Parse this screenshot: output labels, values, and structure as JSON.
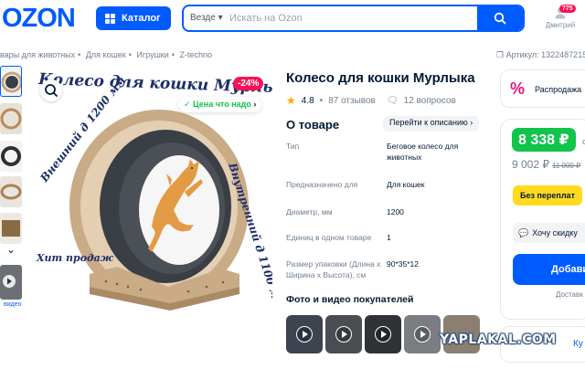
{
  "header": {
    "logo": "OZON",
    "catalog_label": "Каталог",
    "search_scope": "Везде",
    "search_placeholder": "Искать на Ozon",
    "user_label": "Дмитрий",
    "notifications_count": "775"
  },
  "breadcrumbs": [
    "вары для животных",
    "Для кошек",
    "Игрушки",
    "Z-techno"
  ],
  "article": "Артикул: 1322487215",
  "gallery": {
    "video_label": "видео",
    "discount": "-24%",
    "good_price": "Цена что надо",
    "image_title": "Колесо для кошки Мурлыка",
    "outer_diameter": "Внешний д 1200 мм",
    "inner_diameter": "Внутренний д 1100 мм",
    "hit": "Хит продаж"
  },
  "product": {
    "title": "Колесо для кошки Мурлыка",
    "rating": "4.8",
    "reviews": "87 отзывов",
    "questions": "12 вопросов",
    "about_title": "О товаре",
    "to_description": "Перейти к описанию",
    "specs": [
      {
        "key": "Тип",
        "value": "Беговое колесо для животных"
      },
      {
        "key": "Предназначено для",
        "value": "Для кошек"
      },
      {
        "key": "Диаметр, мм",
        "value": "1200"
      },
      {
        "key": "Единиц в одном товаре",
        "value": "1"
      },
      {
        "key": "Размер упаковки (Длина х Ширина х Высота), см",
        "value": "90*35*12"
      }
    ],
    "photos_title": "Фото и видео покупателей"
  },
  "buy": {
    "sale_label": "Распродажа",
    "price": "8 338 ₽",
    "price_suffix": "с",
    "old_price": "9 002 ₽",
    "old_price_strike": "11 000 ₽",
    "no_overpay": "Без переплат",
    "want_discount": "Хочу скидку",
    "add_button": "Добави",
    "delivery": "Доставк",
    "bottom_label": "Ку"
  },
  "watermark": "YAPLAKAL.COM",
  "colors": {
    "brand_blue": "#005bff",
    "price_green": "#10c44c",
    "discount_pink": "#f91155",
    "no_overpay_yellow": "#ffda1f"
  }
}
